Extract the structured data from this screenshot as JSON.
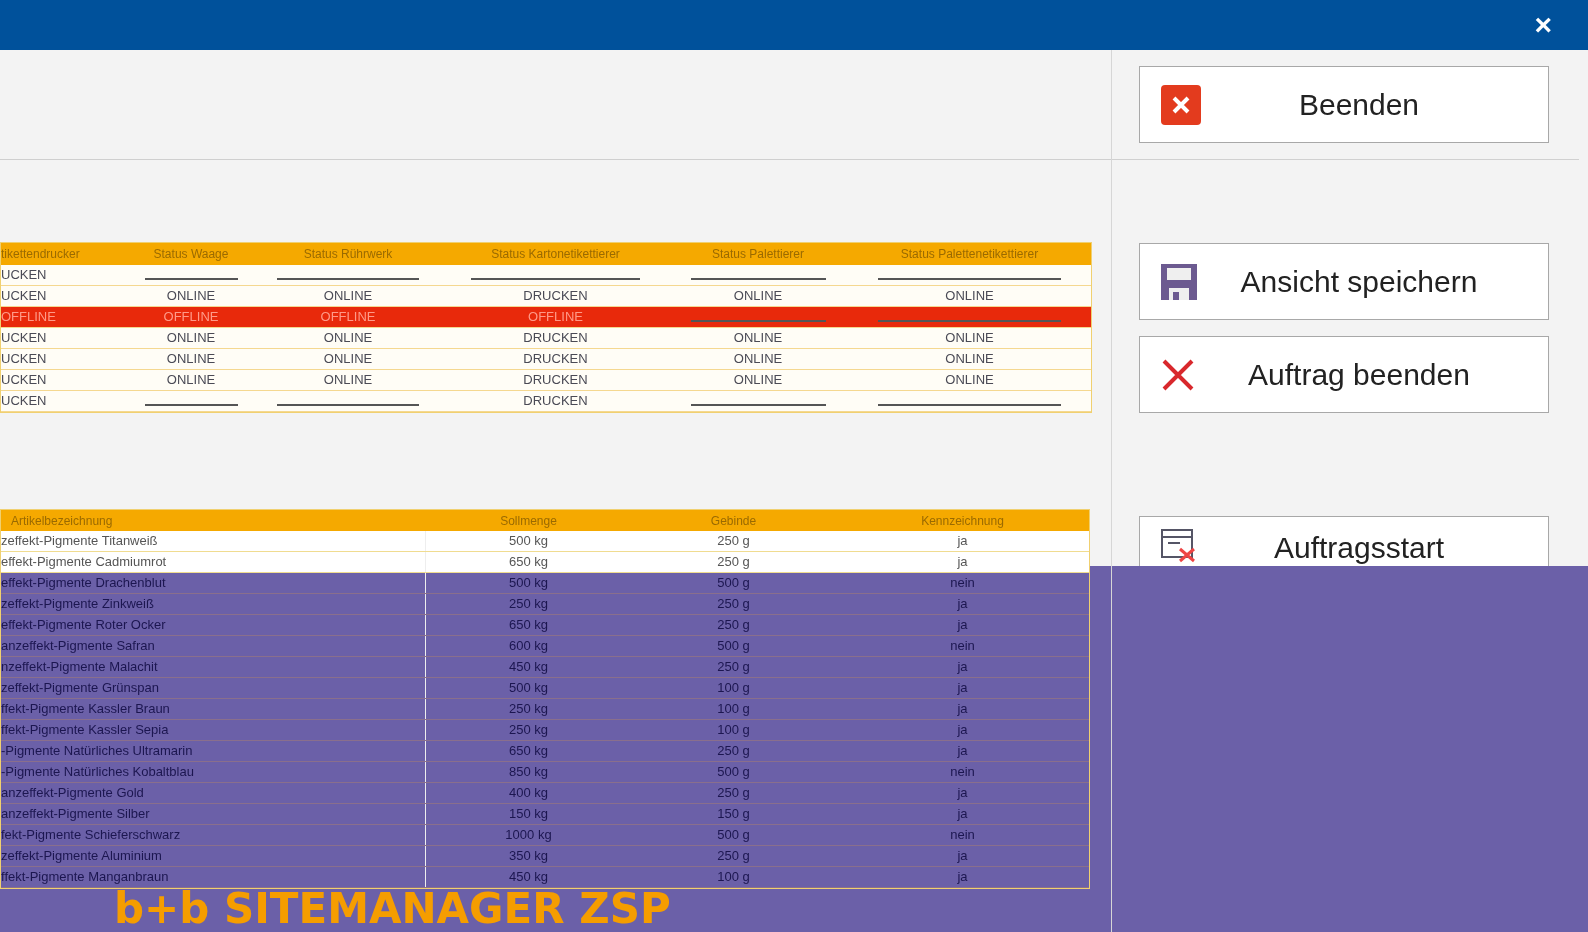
{
  "window": {
    "close": "×"
  },
  "buttons": [
    {
      "label": "Beenden"
    },
    {
      "label": "Ansicht speichern"
    },
    {
      "label": "Auftrag beenden"
    },
    {
      "label": "Auftragsstart"
    }
  ],
  "status_table": {
    "columns": [
      "tikettendrucker",
      "Status Waage",
      "Status Rührwerk",
      "Status Kartonetikettierer",
      "Status Palettierer",
      "Status Palettenetikettierer"
    ],
    "rows": [
      {
        "alert": false,
        "cells": [
          "UCKEN",
          null,
          null,
          null,
          null,
          null
        ]
      },
      {
        "alert": false,
        "cells": [
          "UCKEN",
          "ONLINE",
          "ONLINE",
          "DRUCKEN",
          "ONLINE",
          "ONLINE"
        ]
      },
      {
        "alert": true,
        "cells": [
          "OFFLINE",
          "OFFLINE",
          "OFFLINE",
          "OFFLINE",
          null,
          null
        ]
      },
      {
        "alert": false,
        "cells": [
          "UCKEN",
          "ONLINE",
          "ONLINE",
          "DRUCKEN",
          "ONLINE",
          "ONLINE"
        ]
      },
      {
        "alert": false,
        "cells": [
          "UCKEN",
          "ONLINE",
          "ONLINE",
          "DRUCKEN",
          "ONLINE",
          "ONLINE"
        ]
      },
      {
        "alert": false,
        "cells": [
          "UCKEN",
          "ONLINE",
          "ONLINE",
          "DRUCKEN",
          "ONLINE",
          "ONLINE"
        ]
      },
      {
        "alert": false,
        "cells": [
          "UCKEN",
          null,
          null,
          "DRUCKEN",
          null,
          null
        ]
      }
    ]
  },
  "article_table": {
    "columns": [
      "Artikelbezeichnung",
      "Sollmenge",
      "Gebinde",
      "Kennzeichnung"
    ],
    "rows": [
      [
        "zeffekt-Pigmente Titanweiß",
        "500 kg",
        "250 g",
        "ja"
      ],
      [
        "effekt-Pigmente Cadmiumrot",
        "650 kg",
        "250 g",
        "ja"
      ],
      [
        "effekt-Pigmente Drachenblut",
        "500 kg",
        "500 g",
        "nein"
      ],
      [
        "zeffekt-Pigmente Zinkweiß",
        "250 kg",
        "250 g",
        "ja"
      ],
      [
        "effekt-Pigmente Roter Ocker",
        "650 kg",
        "250 g",
        "ja"
      ],
      [
        "anzeffekt-Pigmente Safran",
        "600 kg",
        "500 g",
        "nein"
      ],
      [
        "nzeffekt-Pigmente Malachit",
        "450 kg",
        "250 g",
        "ja"
      ],
      [
        "zeffekt-Pigmente Grünspan",
        "500 kg",
        "100 g",
        "ja"
      ],
      [
        "ffekt-Pigmente Kassler Braun",
        "250 kg",
        "100 g",
        "ja"
      ],
      [
        "ffekt-Pigmente Kassler Sepia",
        "250 kg",
        "100 g",
        "ja"
      ],
      [
        "-Pigmente Natürliches Ultramarin",
        "650 kg",
        "250 g",
        "ja"
      ],
      [
        "-Pigmente Natürliches Kobaltblau",
        "850 kg",
        "500 g",
        "nein"
      ],
      [
        "anzeffekt-Pigmente Gold",
        "400 kg",
        "250 g",
        "ja"
      ],
      [
        "anzeffekt-Pigmente Silber",
        "150 kg",
        "150 g",
        "ja"
      ],
      [
        "fekt-Pigmente Schieferschwarz",
        "1000 kg",
        "500 g",
        "nein"
      ],
      [
        "zeffekt-Pigmente Aluminium",
        "350 kg",
        "250 g",
        "ja"
      ],
      [
        "ffekt-Pigmente Manganbraun",
        "450 kg",
        "100 g",
        "ja"
      ]
    ]
  },
  "caption": "b+b SITEMANAGER ZSP"
}
